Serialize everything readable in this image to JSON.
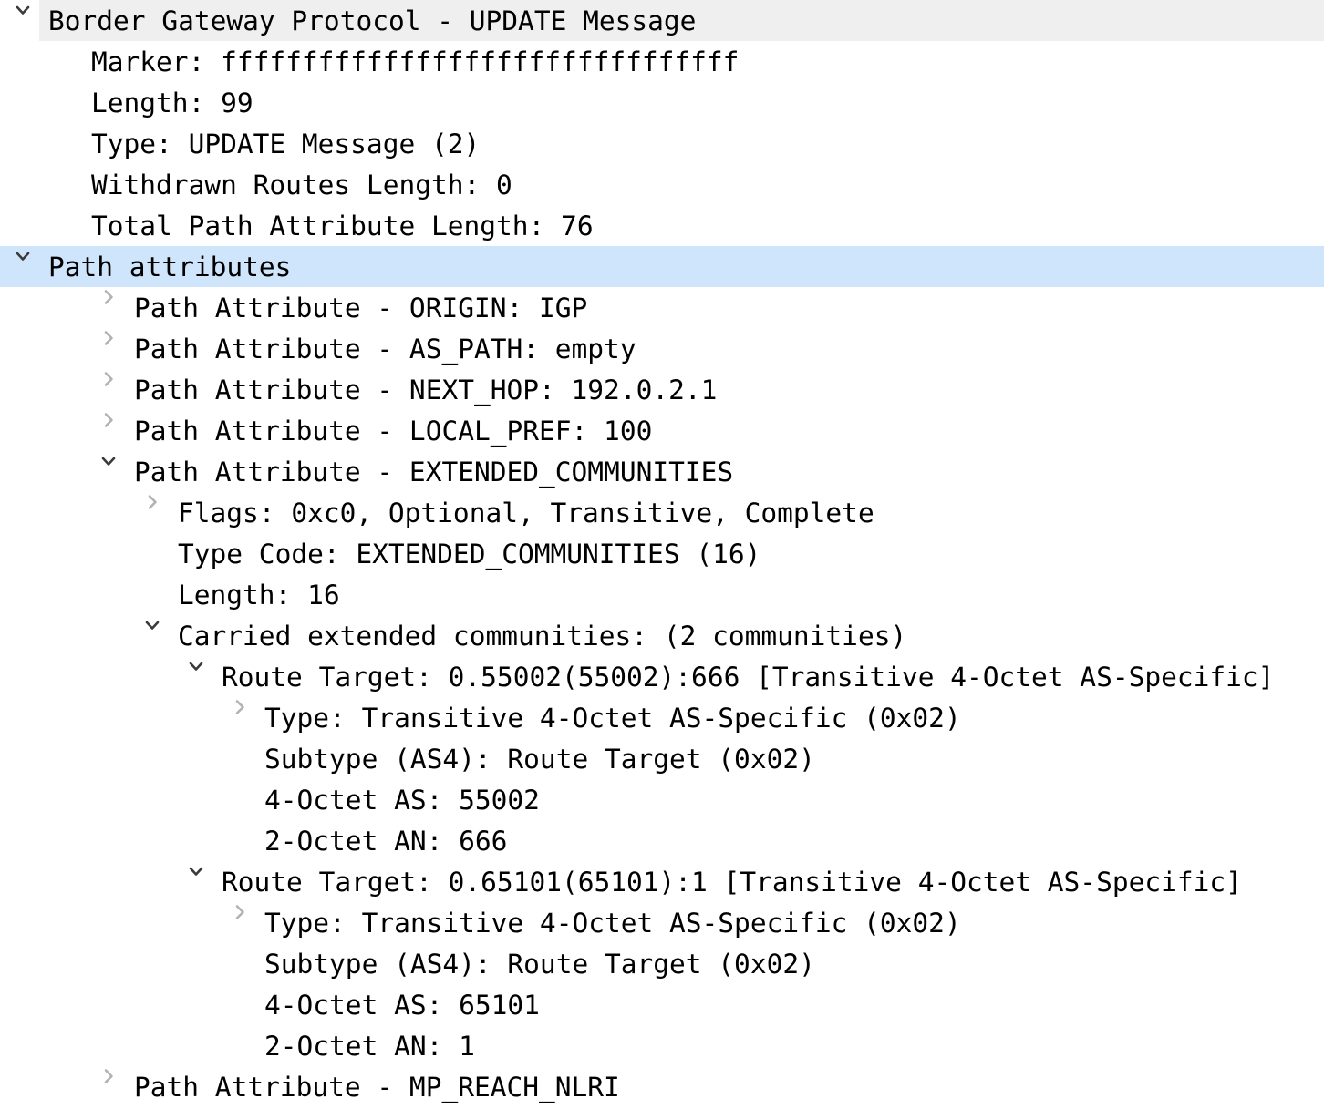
{
  "colors": {
    "selection_background": "#cfe5fb",
    "header_row_background": "#efefef",
    "text": "#000000",
    "twisty_open": "#3b3b3b",
    "twisty_closed": "#b2b2b2",
    "page_background": "#ffffff"
  },
  "protocol_tree": {
    "rows": [
      {
        "text": "Border Gateway Protocol - UPDATE Message",
        "level": 0,
        "twisty": "expanded",
        "state": "header"
      },
      {
        "text": "Marker: ffffffffffffffffffffffffffffffff",
        "level": 1,
        "twisty": "none",
        "state": "normal"
      },
      {
        "text": "Length: 99",
        "level": 1,
        "twisty": "none",
        "state": "normal"
      },
      {
        "text": "Type: UPDATE Message (2)",
        "level": 1,
        "twisty": "none",
        "state": "normal"
      },
      {
        "text": "Withdrawn Routes Length: 0",
        "level": 1,
        "twisty": "none",
        "state": "normal"
      },
      {
        "text": "Total Path Attribute Length: 76",
        "level": 1,
        "twisty": "none",
        "state": "normal"
      },
      {
        "text": "Path attributes",
        "level": 0,
        "twisty": "expanded",
        "state": "selected"
      },
      {
        "text": "Path Attribute - ORIGIN: IGP",
        "level": 2,
        "twisty": "collapsed",
        "state": "normal"
      },
      {
        "text": "Path Attribute - AS_PATH: empty",
        "level": 2,
        "twisty": "collapsed",
        "state": "normal"
      },
      {
        "text": "Path Attribute - NEXT_HOP: 192.0.2.1",
        "level": 2,
        "twisty": "collapsed",
        "state": "normal"
      },
      {
        "text": "Path Attribute - LOCAL_PREF: 100",
        "level": 2,
        "twisty": "collapsed",
        "state": "normal"
      },
      {
        "text": "Path Attribute - EXTENDED_COMMUNITIES",
        "level": 2,
        "twisty": "expanded",
        "state": "normal"
      },
      {
        "text": "Flags: 0xc0, Optional, Transitive, Complete",
        "level": 3,
        "twisty": "collapsed",
        "state": "normal"
      },
      {
        "text": "Type Code: EXTENDED_COMMUNITIES (16)",
        "level": 3,
        "twisty": "none",
        "state": "normal"
      },
      {
        "text": "Length: 16",
        "level": 3,
        "twisty": "none",
        "state": "normal"
      },
      {
        "text": "Carried extended communities: (2 communities)",
        "level": 3,
        "twisty": "expanded",
        "state": "normal"
      },
      {
        "text": "Route Target: 0.55002(55002):666 [Transitive 4-Octet AS-Specific]",
        "level": 4,
        "twisty": "expanded",
        "state": "normal"
      },
      {
        "text": "Type: Transitive 4-Octet AS-Specific (0x02)",
        "level": 5,
        "twisty": "collapsed",
        "state": "normal"
      },
      {
        "text": "Subtype (AS4): Route Target (0x02)",
        "level": 5,
        "twisty": "none",
        "state": "normal"
      },
      {
        "text": "4-Octet AS: 55002",
        "level": 5,
        "twisty": "none",
        "state": "normal"
      },
      {
        "text": "2-Octet AN: 666",
        "level": 5,
        "twisty": "none",
        "state": "normal"
      },
      {
        "text": "Route Target: 0.65101(65101):1 [Transitive 4-Octet AS-Specific]",
        "level": 4,
        "twisty": "expanded",
        "state": "normal"
      },
      {
        "text": "Type: Transitive 4-Octet AS-Specific (0x02)",
        "level": 5,
        "twisty": "collapsed",
        "state": "normal"
      },
      {
        "text": "Subtype (AS4): Route Target (0x02)",
        "level": 5,
        "twisty": "none",
        "state": "normal"
      },
      {
        "text": "4-Octet AS: 65101",
        "level": 5,
        "twisty": "none",
        "state": "normal"
      },
      {
        "text": "2-Octet AN: 1",
        "level": 5,
        "twisty": "none",
        "state": "normal"
      },
      {
        "text": "Path Attribute - MP_REACH_NLRI",
        "level": 2,
        "twisty": "collapsed",
        "state": "normal"
      }
    ]
  }
}
